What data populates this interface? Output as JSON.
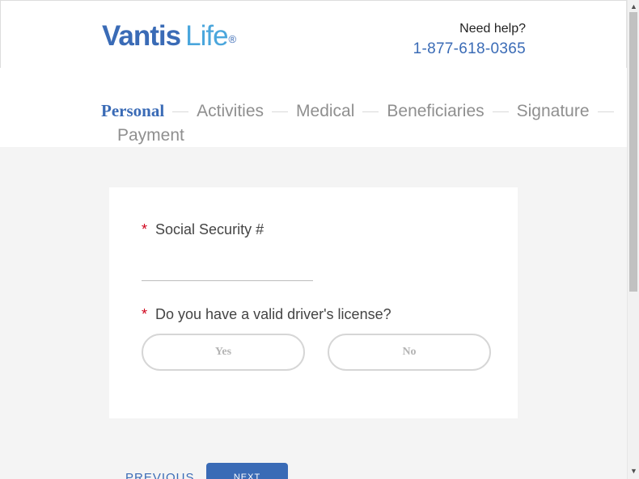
{
  "header": {
    "logo_main": "Vantis",
    "logo_sub": "Life",
    "logo_reg": "®",
    "help_question": "Need help?",
    "help_phone": "1-877-618-0365"
  },
  "steps": [
    {
      "label": "Personal",
      "active": true
    },
    {
      "label": "Activities",
      "active": false
    },
    {
      "label": "Medical",
      "active": false
    },
    {
      "label": "Beneficiaries",
      "active": false
    },
    {
      "label": "Signature",
      "active": false
    },
    {
      "label": "Payment",
      "active": false
    }
  ],
  "form": {
    "required_marker": "*",
    "ssn_label": "Social Security #",
    "ssn_value": "",
    "license_label": "Do you have a valid driver's license?",
    "yes_label": "Yes",
    "no_label": "No"
  },
  "nav": {
    "previous_label": "PREVIOUS",
    "next_label": "NEXT"
  },
  "colors": {
    "brand_blue": "#3a6bb6",
    "brand_light_blue": "#4aa6dc",
    "required_red": "#d0021b"
  }
}
